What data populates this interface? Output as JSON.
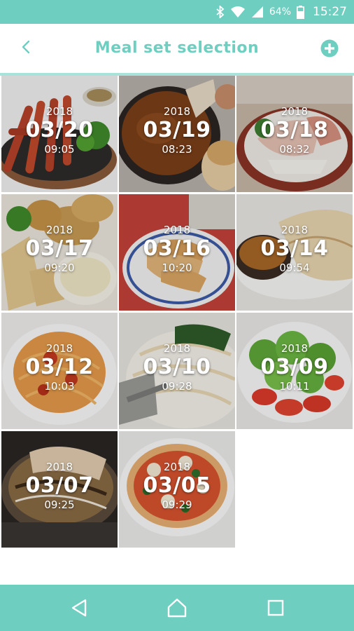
{
  "status_bar": {
    "battery_percent": "64%",
    "time": "15:27",
    "icons": [
      "bluetooth-icon",
      "wifi-icon",
      "signal-icon",
      "battery-icon"
    ]
  },
  "header": {
    "title": "Meal set selection",
    "back_icon": "chevron-left-icon",
    "add_icon": "plus-circle-icon"
  },
  "meals": [
    {
      "year": "2018",
      "date": "03/20",
      "time": "09:05",
      "photo": "sausages"
    },
    {
      "year": "2018",
      "date": "03/19",
      "time": "08:23",
      "photo": "soup-bread"
    },
    {
      "year": "2018",
      "date": "03/18",
      "time": "08:32",
      "photo": "sashimi"
    },
    {
      "year": "2018",
      "date": "03/17",
      "time": "09:20",
      "photo": "fried-potato"
    },
    {
      "year": "2018",
      "date": "03/16",
      "time": "10:20",
      "photo": "gyoza"
    },
    {
      "year": "2018",
      "date": "03/14",
      "time": "09:54",
      "photo": "curry-naan"
    },
    {
      "year": "2018",
      "date": "03/12",
      "time": "10:03",
      "photo": "spaghetti"
    },
    {
      "year": "2018",
      "date": "03/10",
      "time": "09:28",
      "photo": "pasta-spinach"
    },
    {
      "year": "2018",
      "date": "03/09",
      "time": "10:11",
      "photo": "tomato-salad"
    },
    {
      "year": "2018",
      "date": "03/07",
      "time": "09:25",
      "photo": "okonomiyaki"
    },
    {
      "year": "2018",
      "date": "03/05",
      "time": "09:29",
      "photo": "pizza"
    }
  ],
  "nav": {
    "icons": [
      "back-triangle-icon",
      "home-icon",
      "recents-square-icon"
    ]
  },
  "colors": {
    "accent": "#6ecfc0",
    "header_border": "#a8e2d8"
  }
}
